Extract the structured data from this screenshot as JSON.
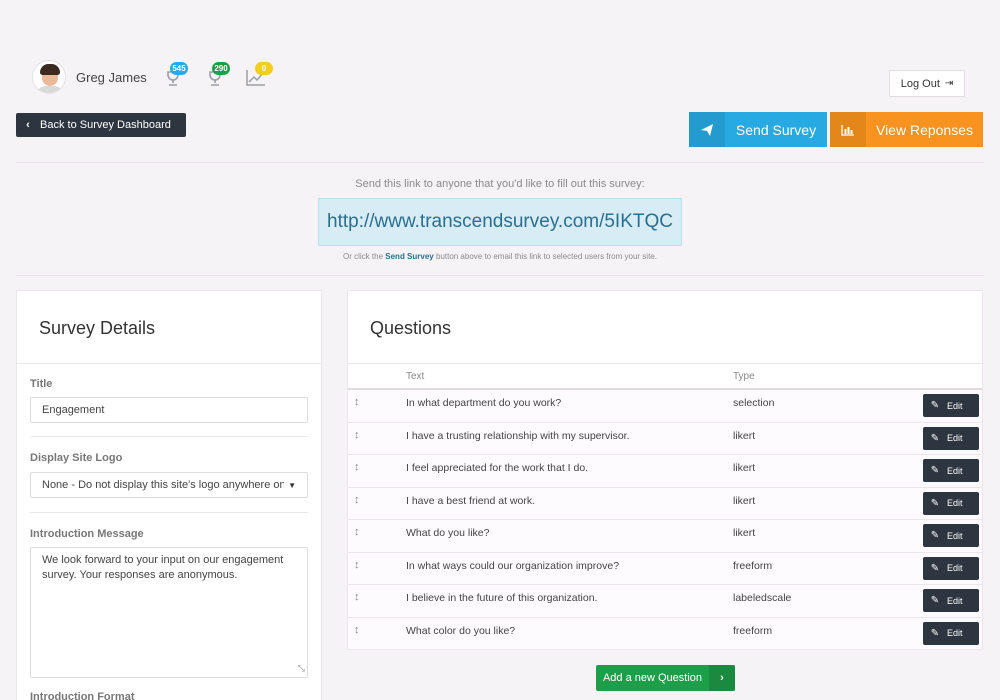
{
  "user": {
    "name": "Greg James"
  },
  "stats": [
    {
      "icon": "trophy-icon",
      "count": "545",
      "color": "#27a9e1"
    },
    {
      "icon": "trophy-icon",
      "count": "290",
      "color": "#1f9e4a"
    },
    {
      "icon": "chart-line-icon",
      "count": "0",
      "color": "#f2cf1f"
    }
  ],
  "header": {
    "logout_label": "Log Out",
    "back_label": "Back to Survey Dashboard",
    "send_survey_label": "Send Survey",
    "view_responses_label": "View Reponses"
  },
  "share": {
    "intro": "Send this link to anyone that you'd like to fill out this survey:",
    "link": "http://www.transcendsurvey.com/5IKTQC",
    "note_prefix": "Or click the",
    "note_button": "Send Survey",
    "note_suffix": "button above to email this link to selected users from your site."
  },
  "details": {
    "title": "Survey Details",
    "title_label": "Title",
    "title_value": "Engagement",
    "logo_label": "Display Site Logo",
    "logo_value": "None - Do not display this site's logo anywhere on t",
    "intro_label": "Introduction Message",
    "intro_value": "We look forward to your input on our engagement survey. Your responses are anonymous.",
    "next_label": "Introduction Format"
  },
  "questions": {
    "title": "Questions",
    "col_text": "Text",
    "col_type": "Type",
    "edit_label": "Edit",
    "rows": [
      {
        "text": "In what department do you work?",
        "type": "selection"
      },
      {
        "text": "I have a trusting relationship with my supervisor.",
        "type": "likert"
      },
      {
        "text": "I feel appreciated for the work that I do.",
        "type": "likert"
      },
      {
        "text": "I have a best friend at work.",
        "type": "likert"
      },
      {
        "text": "What do you like?",
        "type": "likert"
      },
      {
        "text": "In what ways could our organization improve?",
        "type": "freeform"
      },
      {
        "text": "I believe in the future of this organization.",
        "type": "labeledscale"
      },
      {
        "text": "What color do you like?",
        "type": "freeform"
      }
    ],
    "add_label": "Add a new Question"
  },
  "colors": {
    "accent_blue": "#27a9e1",
    "accent_orange": "#f7931e",
    "accent_green": "#1f9e4a",
    "dark": "#2c3540"
  }
}
